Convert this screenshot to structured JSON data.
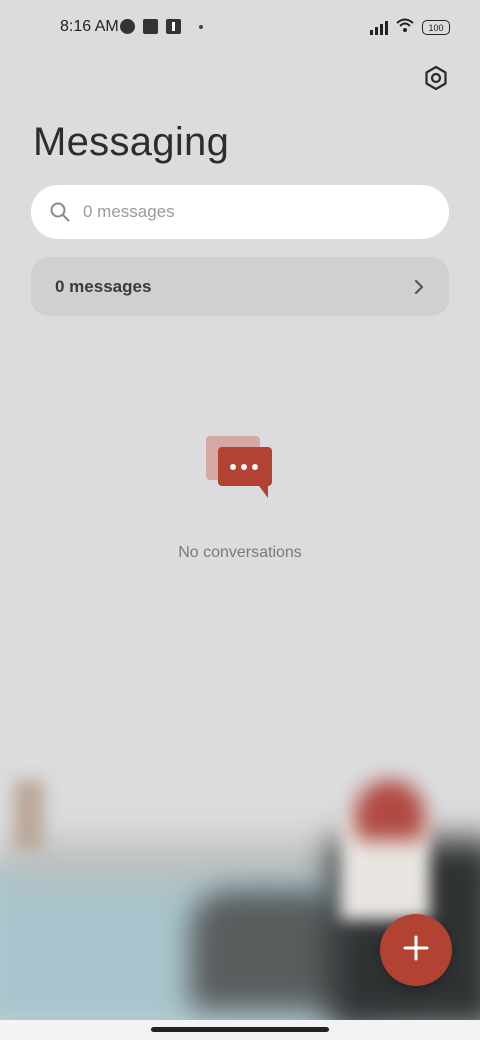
{
  "status_bar": {
    "time": "8:16 AM",
    "battery": "100",
    "icons": [
      "app-notification-icon",
      "square-notification-icon",
      "upload-icon",
      "dot-icon",
      "signal-icon",
      "wifi-icon",
      "battery-icon"
    ]
  },
  "header": {
    "title": "Messaging",
    "settings_icon": "settings-icon"
  },
  "search": {
    "placeholder": "0 messages",
    "icon": "search-icon"
  },
  "messages_row": {
    "label": "0 messages",
    "icon": "chevron-right-icon"
  },
  "empty_state": {
    "text": "No conversations",
    "icon": "chat-bubbles-icon"
  },
  "fab": {
    "icon": "plus-icon"
  },
  "colors": {
    "accent": "#b24232",
    "background": "#dcdcde",
    "search_bg": "#ffffff",
    "row_bg": "#d0d0d2"
  }
}
